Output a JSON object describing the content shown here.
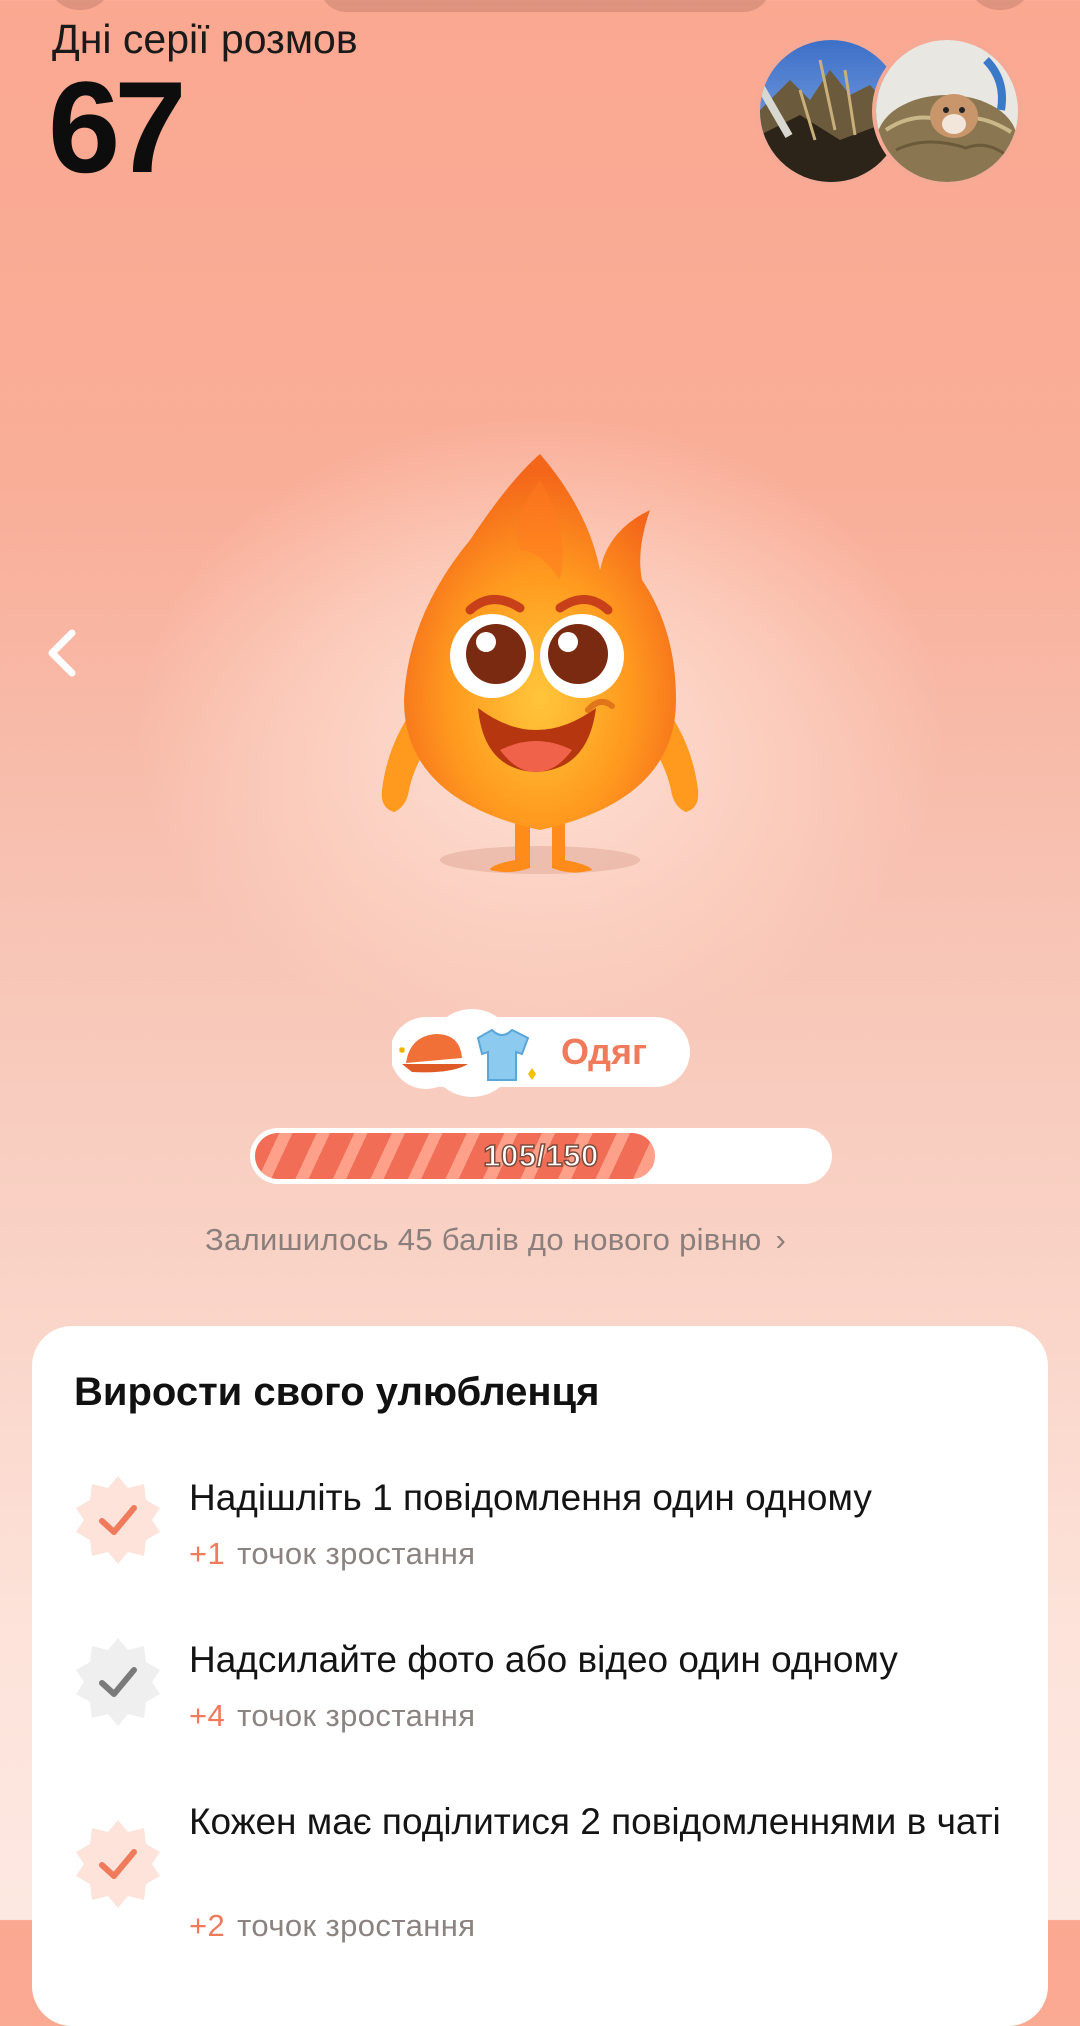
{
  "header": {
    "streak_label": "Дні серії розмов",
    "streak_count": "67"
  },
  "avatars": [
    {
      "name": "avatar-outdoor-photo"
    },
    {
      "name": "avatar-hamster-photo"
    }
  ],
  "pet": {
    "reward_label": "Одяг",
    "progress_text": "105/150",
    "progress_fraction": 0.7,
    "remaining_text": "Залишилось 45 балів до нового рівню",
    "accent_color": "#f07a5c"
  },
  "tasks_card": {
    "title": "Вирости свого улюбленця",
    "tasks": [
      {
        "title": "Надішліть 1 повідомлення один одному",
        "plus": "+1",
        "points_label": "точок зростання",
        "status": "done"
      },
      {
        "title": "Надсилайте фото або відео один одному",
        "plus": "+4",
        "points_label": "точок зростання",
        "status": "pending"
      },
      {
        "title": "Кожен має поділитися 2 повідомленнями в чаті",
        "plus": "+2",
        "points_label": "точок зростання",
        "status": "done"
      }
    ]
  }
}
